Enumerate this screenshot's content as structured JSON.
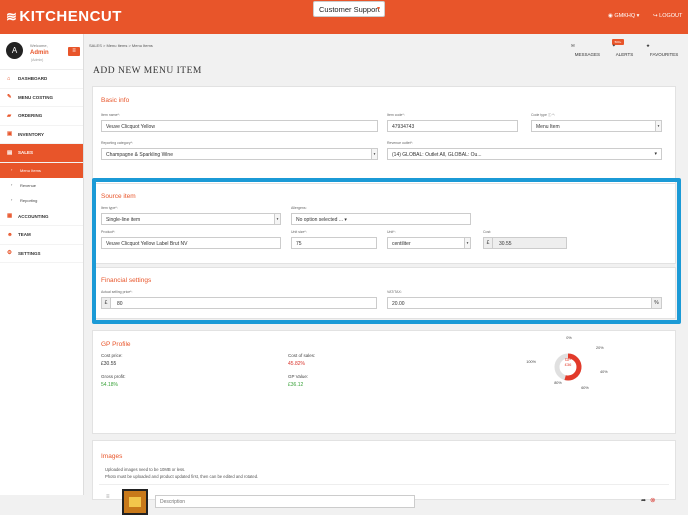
{
  "app": {
    "logo_text": "KITCHENCUT",
    "support_label": "Customer Support",
    "org": "GMKHQ",
    "logout": "LOGOUT"
  },
  "user": {
    "avatar": "A",
    "welcome": "Welcome,",
    "name": "Admin",
    "id": "(Admin)"
  },
  "sidebar": {
    "items": [
      "DASHBOARD",
      "MENU COSTING",
      "ORDERING",
      "INVENTORY",
      "SALES"
    ],
    "subitems": [
      "Menu Items",
      "Revenue",
      "Reporting"
    ],
    "items2": [
      "ACCOUNTING",
      "TEAM",
      "SETTINGS"
    ]
  },
  "breadcrumb": "SALES  >  Menu Items  >  Menu Items",
  "top_links": {
    "messages": "MESSAGES",
    "alerts": "ALERTS",
    "alerts_badge": "500+",
    "favourites": "FAVOURITES"
  },
  "page_title": "ADD NEW MENU ITEM",
  "basic": {
    "title": "Basic info",
    "item_name_label": "Item name*:",
    "item_name": "Veuve Clicquot Yellow",
    "item_code_label": "Item code*:",
    "item_code": "47934743",
    "code_type_label": "Code type ⓘ *:",
    "code_type": "Menu Item",
    "reporting_label": "Reporting category*:",
    "reporting": "Champagne & Sparkling Wine",
    "outlet_label": "Revenue outlet*:",
    "outlet": "(14) GLOBAL: Outlet All, GLOBAL: Ou..."
  },
  "source": {
    "title": "Source item",
    "item_type_label": "Item type*:",
    "item_type": "Single-line item",
    "allergens_label": "Allergens:",
    "allergens": "No option selected ...",
    "product_label": "Product*:",
    "product": "Veuve Clicquot Yellow Label Brut NV",
    "unit_size_label": "Unit size*:",
    "unit_size": "75",
    "unit_label": "Unit*:",
    "unit": "centiliter",
    "cost_label": "Cost:",
    "cost_currency": "£",
    "cost": "30.55"
  },
  "financial": {
    "title": "Financial settings",
    "price_label": "Actual selling price*:",
    "price_currency": "£",
    "price": "80",
    "vat_label": "VAT/TAX:",
    "vat": "20.00",
    "vat_suffix": "%"
  },
  "gp": {
    "title": "GP Profile",
    "cost_price_label": "Cost price:",
    "cost_price": "£30.55",
    "cost_of_sales_label": "Cost of sales:",
    "cost_of_sales": "45.82%",
    "gross_profit_label": "Gross profit:",
    "gross_profit": "54.18%",
    "gp_value_label": "GP Value:",
    "gp_value": "£36.12",
    "gauge": {
      "gp_label": "GP",
      "gp_value": "£36",
      "ticks": [
        "0%",
        "20%",
        "40%",
        "60%",
        "80%",
        "100%"
      ],
      "fraction": 0.5418,
      "color": "#e23a2a"
    }
  },
  "images": {
    "title": "Images",
    "note1": "Uploaded images need to be 10MB or less.",
    "note2": "Photo must be uploaded and product updated first, then can be edited and rotated.",
    "desc_placeholder": "Description"
  },
  "colors": {
    "accent": "#e8552a",
    "highlight": "#1b9ad6",
    "green": "#3aa23a",
    "red": "#d9322a"
  }
}
